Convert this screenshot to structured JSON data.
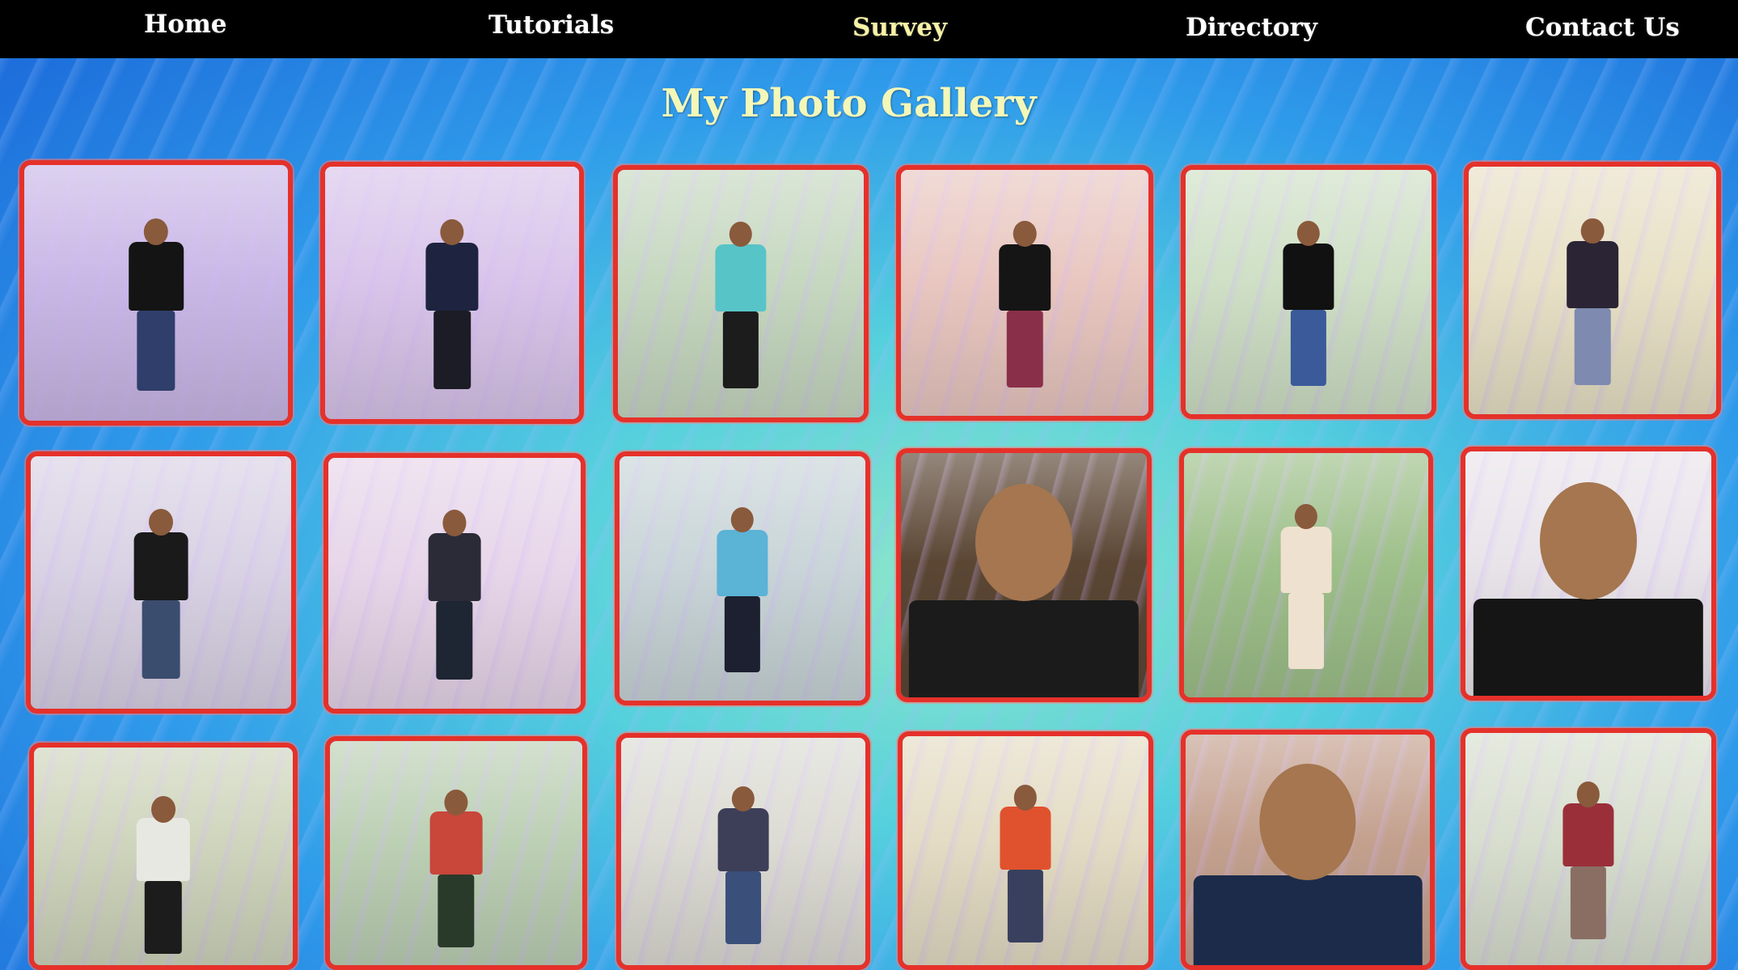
{
  "nav": {
    "items": [
      {
        "label": "Home"
      },
      {
        "label": "Tutorials"
      },
      {
        "label": "Survey"
      },
      {
        "label": "Directory"
      },
      {
        "label": "Contact Us"
      }
    ]
  },
  "page_title": "My Photo Gallery",
  "colors": {
    "navbar_bg": "#000000",
    "nav_text": "#ffffff",
    "nav_active": "#f8f2a6",
    "title_text": "#f3f7b8",
    "photo_border": "#e5312a"
  },
  "gallery": {
    "photos": [
      {
        "scene": "person-seated-dark-shirt",
        "bg": "#c9b8e6",
        "shirt": "#141414",
        "pants": "#2f3e6b"
      },
      {
        "scene": "person-standing-plaid-shirt",
        "bg": "#d9c5ea",
        "shirt": "#1e2440",
        "pants": "#1c1c26"
      },
      {
        "scene": "person-on-walkway",
        "bg": "#c6d8c0",
        "shirt": "#57c4c8",
        "pants": "#1c1c1c"
      },
      {
        "scene": "person-on-boat",
        "bg": "#e9c7c0",
        "shirt": "#151515",
        "pants": "#8a2f49"
      },
      {
        "scene": "person-leaning-rail",
        "bg": "#cfe0c6",
        "shirt": "#111111",
        "pants": "#3a5a9a"
      },
      {
        "scene": "person-by-flowers",
        "bg": "#e8e1c6",
        "shirt": "#2a2434",
        "pants": "#7e8ab0"
      },
      {
        "scene": "person-crouching",
        "bg": "#d9d2e4",
        "shirt": "#1a1a1a",
        "pants": "#3b4d6e"
      },
      {
        "scene": "person-in-park",
        "bg": "#e7d6e9",
        "shirt": "#2b2b38",
        "pants": "#1e2533"
      },
      {
        "scene": "person-on-boardwalk",
        "bg": "#c9d5d8",
        "shirt": "#5bb3d6",
        "pants": "#1c2030"
      },
      {
        "scene": "selfie-close-up",
        "bg": "#5b4634",
        "shirt": "#1b1b1b",
        "pants": "#1b1b1b"
      },
      {
        "scene": "person-traditional-attire",
        "bg": "#9ec08a",
        "shirt": "#efe1cf",
        "pants": "#efe1cf"
      },
      {
        "scene": "selfie-indoor",
        "bg": "#e9e4ea",
        "shirt": "#151515",
        "pants": "#151515"
      },
      {
        "scene": "person-white-jacket",
        "bg": "#cfd5bc",
        "shirt": "#e8e8e2",
        "pants": "#1c1c1c"
      },
      {
        "scene": "person-arms-out",
        "bg": "#bcd0b4",
        "shirt": "#c8463a",
        "pants": "#2a3a2a"
      },
      {
        "scene": "person-striped-shirt",
        "bg": "#dcdcd4",
        "shirt": "#3d3f58",
        "pants": "#3a4f7a"
      },
      {
        "scene": "person-red-shirt",
        "bg": "#e4dcc4",
        "shirt": "#e0522e",
        "pants": "#38405e"
      },
      {
        "scene": "selfie-dark-jacket",
        "bg": "#c4a18f",
        "shirt": "#1c2b4a",
        "pants": "#1c2b4a"
      },
      {
        "scene": "person-argyle-vest",
        "bg": "#d8dfcf",
        "shirt": "#9a2f3a",
        "pants": "#8a6e64"
      }
    ]
  }
}
